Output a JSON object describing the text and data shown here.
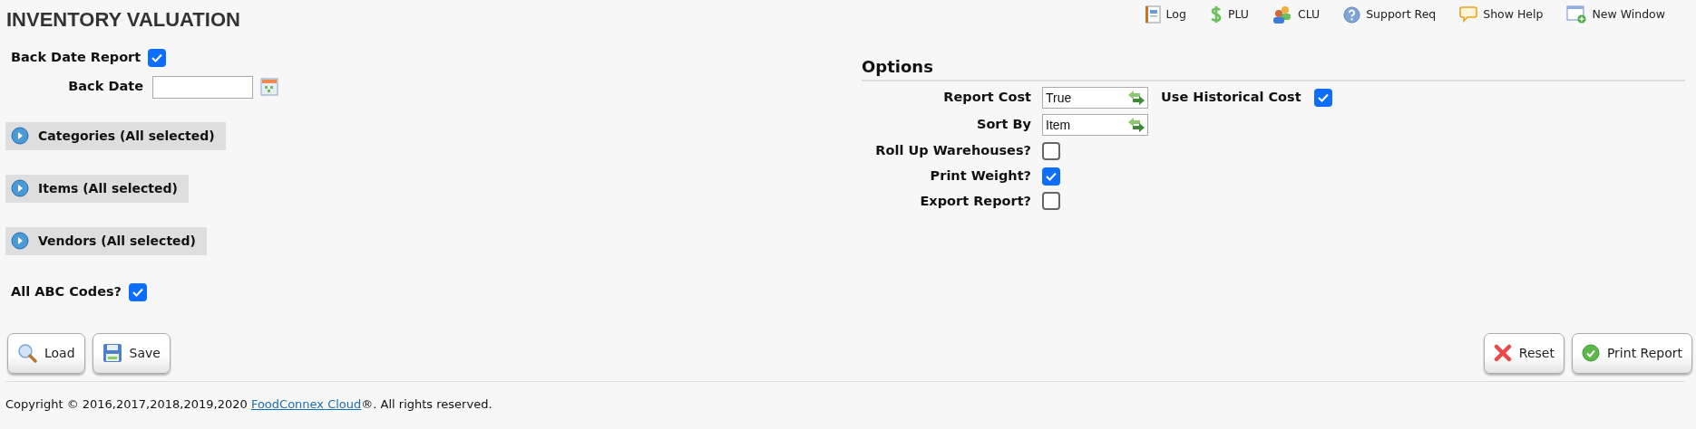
{
  "page": {
    "title": "INVENTORY VALUATION"
  },
  "toolbar": [
    {
      "kind": "log",
      "label": "Log"
    },
    {
      "kind": "dollar",
      "label": "PLU"
    },
    {
      "kind": "people",
      "label": "CLU"
    },
    {
      "kind": "help",
      "label": "Support Req"
    },
    {
      "kind": "bubble",
      "label": "Show Help"
    },
    {
      "kind": "window",
      "label": "New Window"
    }
  ],
  "back_date_report": {
    "label": "Back Date Report",
    "checked": true
  },
  "back_date": {
    "label": "Back Date"
  },
  "sections": [
    {
      "label": "Categories (All selected)",
      "expanded": false
    },
    {
      "label": "Items (All selected)",
      "expanded": false
    },
    {
      "label": "Vendors (All selected)",
      "expanded": false
    }
  ],
  "all_abc_codes": {
    "label": "All ABC Codes?",
    "checked": true
  },
  "options": {
    "title": "Options",
    "rows": [
      {
        "items": [
          {
            "kind": "select",
            "label": "Report Cost",
            "value": "True"
          },
          {
            "kind": "checkbox",
            "label": "Use Historical Cost",
            "checked": true
          }
        ]
      },
      {
        "items": [
          {
            "kind": "select",
            "label": "Sort By",
            "value": "Item"
          }
        ]
      },
      {
        "items": [
          {
            "kind": "checkbox",
            "label": "Roll Up Warehouses?",
            "checked": false
          }
        ]
      },
      {
        "items": [
          {
            "kind": "checkbox",
            "label": "Print Weight?",
            "checked": true
          }
        ]
      },
      {
        "items": [
          {
            "kind": "checkbox",
            "label": "Export Report?",
            "checked": false
          }
        ]
      }
    ]
  },
  "buttons_left": [
    {
      "kind": "load",
      "label": "Load"
    },
    {
      "kind": "save",
      "label": "Save"
    }
  ],
  "buttons_right": [
    {
      "kind": "reset",
      "label": "Reset"
    },
    {
      "kind": "print",
      "label": "Print Report"
    }
  ],
  "footer": {
    "before": "Copyright © 2016,2017,2018,2019,2020 ",
    "link": "FoodConnex Cloud",
    "after": "®. All rights reserved."
  }
}
